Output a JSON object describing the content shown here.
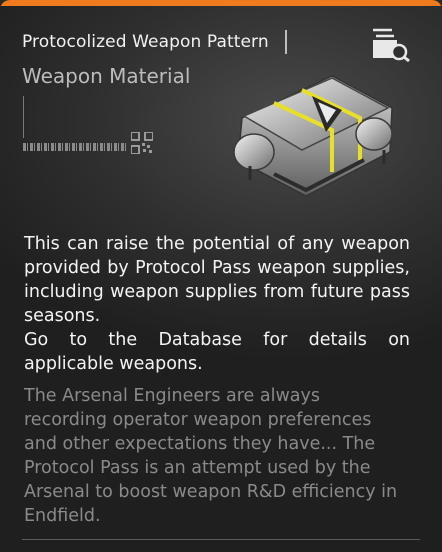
{
  "item": {
    "name": "Protocolized Weapon Pattern",
    "type": "Weapon Material",
    "description": [
      "This can raise the potential of any weapon provided by Protocol Pass weapon supplies, including weapon supplies from future pass seasons.",
      "Go to the Database for details on applicable weapons."
    ],
    "flavor_text": "The Arsenal Engineers are always recording operator weapon preferences and other expectations they have... The Protocol Pass is an attempt used by the Arsenal to boost weapon R&D efficiency in Endfield."
  },
  "icons": {
    "info": "database-search-icon",
    "item_art": "weapon-pattern-case-icon",
    "qr": "qr-code-icon"
  },
  "colors": {
    "accent": "#f07a1e",
    "item_highlight": "#e8df2a"
  }
}
